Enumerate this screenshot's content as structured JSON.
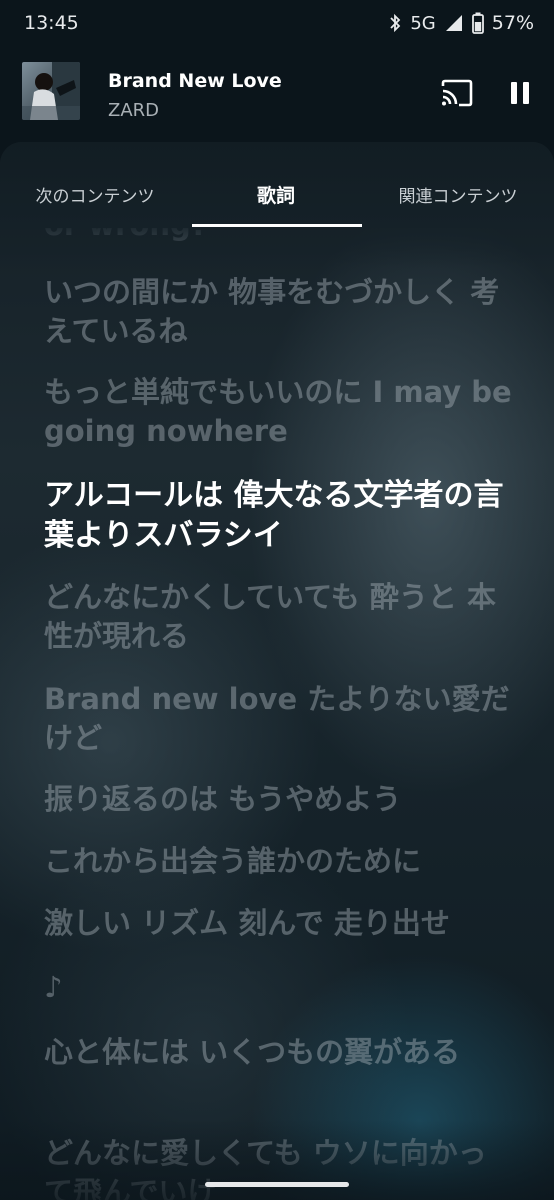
{
  "status_bar": {
    "time": "13:45",
    "network": "5G",
    "battery": "57%",
    "icons": [
      "bluetooth-icon",
      "signal-icon",
      "battery-icon"
    ]
  },
  "mini_player": {
    "title": "Brand New Love",
    "artist": "ZARD",
    "icons": [
      "cast-icon",
      "pause-icon"
    ]
  },
  "tabs": [
    {
      "label": "次のコンテンツ"
    },
    {
      "label": "歌詞"
    },
    {
      "label": "関連コンテンツ"
    }
  ],
  "active_tab": "歌詞",
  "lyrics": {
    "lines": [
      {
        "text": "or wrong?"
      },
      {
        "text": "いつの間にか 物事をむづかしく 考えているね"
      },
      {
        "text": "もっと単純でもいいのに I may be going nowhere"
      },
      {
        "text": "アルコールは 偉大なる文学者の言葉よりスバラシイ"
      },
      {
        "text": "どんなにかくしていても 酔うと 本性が現れる"
      },
      {
        "text": "Brand new love たよりない愛だけど"
      },
      {
        "text": "振り返るのは もうやめよう"
      },
      {
        "text": "これから出会う誰かのために"
      },
      {
        "text": "激しい リズム 刻んで 走り出せ"
      },
      {
        "text": "♪"
      },
      {
        "text": "心と体には いくつもの翼がある"
      },
      {
        "text": "どんなに愛しくても ウソに向かって飛んでいけ"
      }
    ],
    "active_line": "アルコールは 偉大なる文学者の言葉よりスバラシイ"
  },
  "colors": {
    "active_lyric": "#ffffff",
    "inactive_lyric": "#8c979e",
    "tab_indicator": "#ffffff"
  }
}
